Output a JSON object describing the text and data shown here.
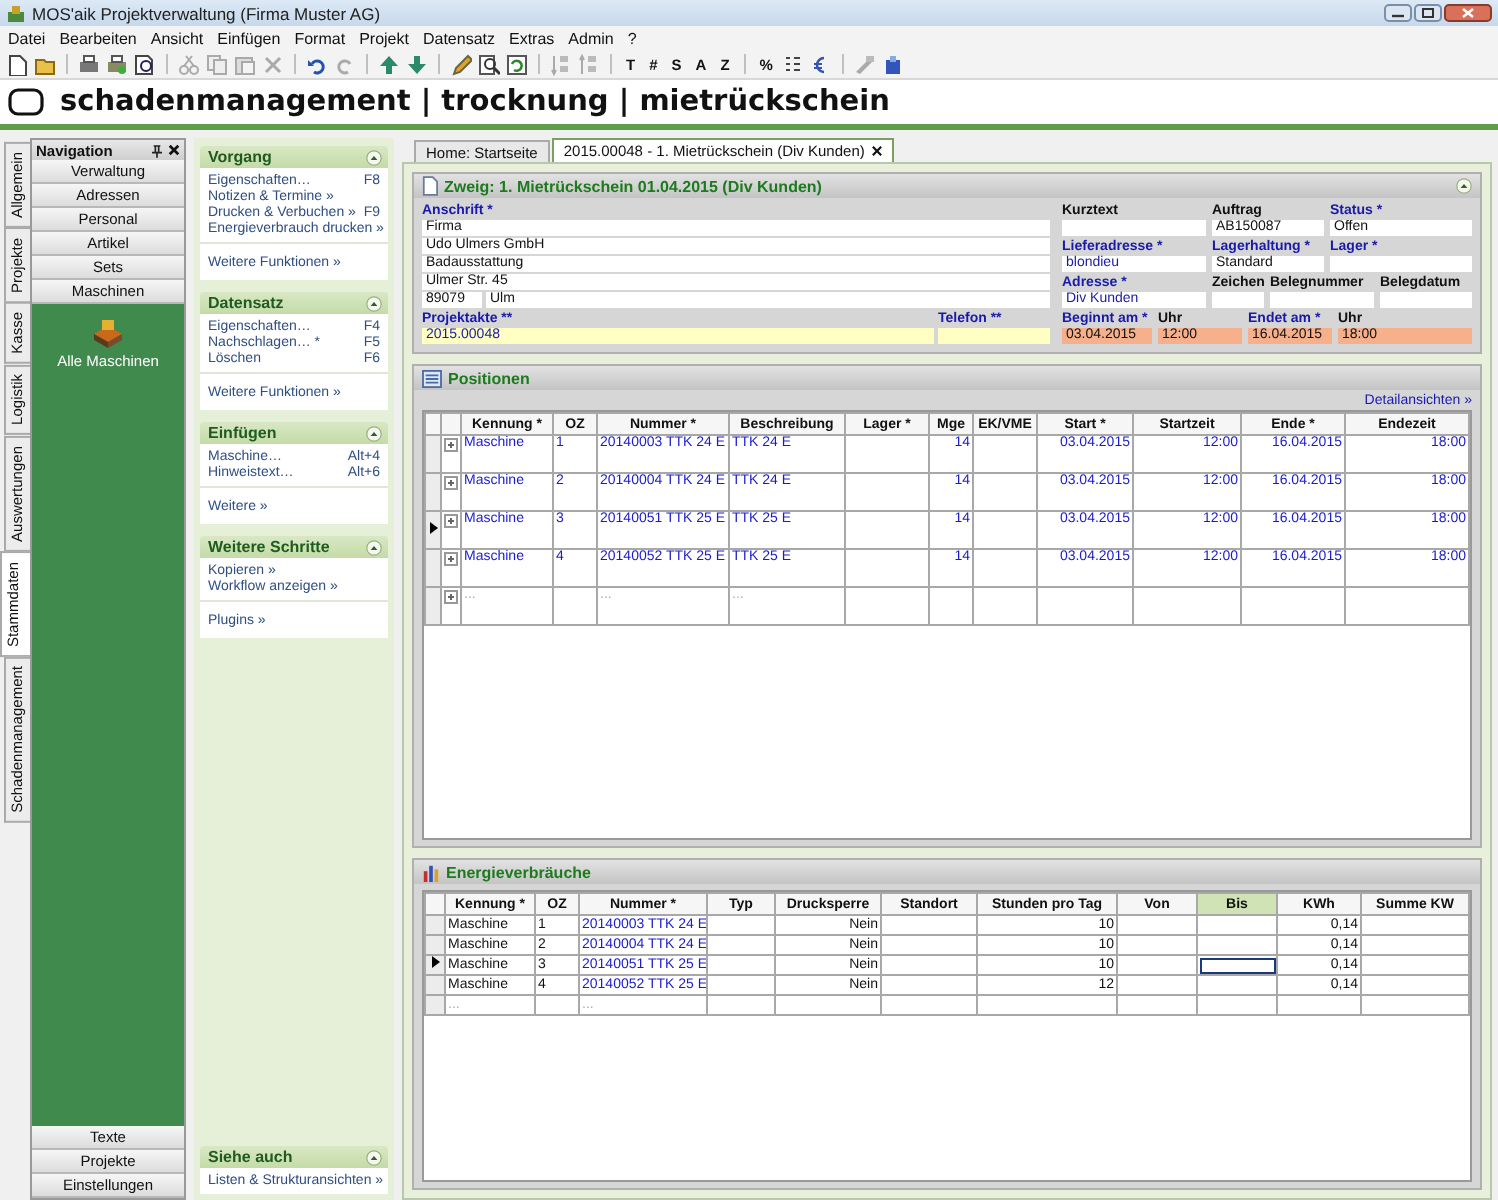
{
  "window": {
    "title": "MOS'aik Projektverwaltung (Firma Muster AG)"
  },
  "menu": [
    "Datei",
    "Bearbeiten",
    "Ansicht",
    "Einfügen",
    "Format",
    "Projekt",
    "Datensatz",
    "Extras",
    "Admin",
    "?"
  ],
  "toolbar": {
    "letters": [
      "T",
      "#",
      "S",
      "A",
      "Z"
    ],
    "percent": "%"
  },
  "banner": {
    "title": "schadenmanagement | trocknung | mietrückschein"
  },
  "side_tabs": [
    {
      "label": "Allgemein",
      "selected": false
    },
    {
      "label": "Projekte",
      "selected": false
    },
    {
      "label": "Kasse",
      "selected": false
    },
    {
      "label": "Logistik",
      "selected": false
    },
    {
      "label": "Auswertungen",
      "selected": false
    },
    {
      "label": "Stammdaten",
      "selected": true
    },
    {
      "label": "Schadenmanagement",
      "selected": false
    }
  ],
  "navigation": {
    "title": "Navigation",
    "top_buttons": [
      "Verwaltung",
      "Adressen",
      "Personal",
      "Artikel",
      "Sets",
      "Maschinen"
    ],
    "items": [
      "Alle Maschinen"
    ],
    "bottom_buttons": [
      "Texte",
      "Projekte",
      "Einstellungen"
    ]
  },
  "tasks": {
    "groups": [
      {
        "title": "Vorgang",
        "items": [
          {
            "label": "Eigenschaften…",
            "shortcut": "F8"
          },
          {
            "label": "Notizen & Termine »"
          },
          {
            "label": "Drucken & Verbuchen »",
            "shortcut": "F9"
          },
          {
            "label": "Energieverbrauch drucken »"
          }
        ],
        "more": [
          "Weitere Funktionen »"
        ]
      },
      {
        "title": "Datensatz",
        "items": [
          {
            "label": "Eigenschaften…",
            "shortcut": "F4"
          },
          {
            "label": "Nachschlagen… *",
            "shortcut": "F5"
          },
          {
            "label": "Löschen",
            "shortcut": "F6"
          }
        ],
        "more": [
          "Weitere Funktionen »"
        ]
      },
      {
        "title": "Einfügen",
        "items": [
          {
            "label": "Maschine…",
            "shortcut": "Alt+4"
          },
          {
            "label": "Hinweistext…",
            "shortcut": "Alt+6"
          }
        ],
        "more": [
          "Weitere »"
        ]
      },
      {
        "title": "Weitere Schritte",
        "items": [
          {
            "label": "Kopieren »"
          },
          {
            "label": "Workflow anzeigen »"
          }
        ],
        "more": [
          "Plugins »"
        ]
      }
    ],
    "see_also": {
      "title": "Siehe auch",
      "links": [
        "Listen & Strukturansichten »"
      ]
    }
  },
  "tabs": [
    {
      "label": "Home: Startseite",
      "selected": false,
      "closable": false
    },
    {
      "label": "2015.00048 - 1. Mietrückschein (Div Kunden)",
      "selected": true,
      "closable": true
    }
  ],
  "form": {
    "title": "Zweig: 1. Mietrückschein 01.04.2015 (Div Kunden)",
    "address": {
      "label": "Anschrift *",
      "required": true,
      "lines": [
        "Firma",
        "Udo Ulmers GmbH",
        "Badausstattung",
        "Ulmer Str. 45"
      ],
      "zip": "89079",
      "city": "Ulm"
    },
    "project": {
      "label": "Projektakte **",
      "required": true,
      "value": "2015.00048",
      "color": "#ffffc4",
      "linked": true
    },
    "phone": {
      "label": "Telefon **",
      "required": true,
      "color": "#ffffc4"
    },
    "grid": [
      [
        {
          "label": "Kurztext",
          "required": false,
          "color": "#ffffff"
        },
        {
          "label": "Auftrag",
          "required": false,
          "value": "AB150087",
          "color": "#ffffff",
          "linked": false
        },
        {
          "label": "Status *",
          "required": true,
          "value": "Offen",
          "color": "#ffffff",
          "linked": false
        }
      ],
      [
        {
          "label": "Lieferadresse *",
          "required": true,
          "value": "blondieu",
          "color": "#ffffff",
          "linked": true
        },
        {
          "label": "Lagerhaltung *",
          "required": true,
          "value": "Standard",
          "color": "#ffffff",
          "linked": false
        },
        {
          "label": "Lager *",
          "required": true,
          "color": "#ffffff"
        }
      ],
      [
        {
          "label": "Adresse *",
          "required": true,
          "value": "Div Kunden",
          "color": "#ffffff",
          "linked": true
        },
        {
          "label": "Zeichen",
          "required": false,
          "color": "#ffffff"
        },
        {
          "label": "Belegnummer",
          "required": false,
          "color": "#ffffff"
        },
        {
          "label": "Belegdatum",
          "required": false,
          "color": "#ffffff"
        }
      ],
      [
        {
          "label": "Beginnt am *",
          "required": true,
          "value": "03.04.2015",
          "color": "#f6b08c",
          "linked": false
        },
        {
          "label": "Uhr",
          "required": false,
          "value": "12:00",
          "color": "#f6b08c",
          "linked": false
        },
        {
          "label": "Endet am *",
          "required": true,
          "value": "16.04.2015",
          "color": "#f6b08c",
          "linked": false
        },
        {
          "label": "Uhr",
          "required": false,
          "value": "18:00",
          "color": "#f6b08c",
          "linked": false
        }
      ]
    ]
  },
  "positions": {
    "title": "Positionen",
    "link": "Detailansichten »",
    "columns": [
      "Kennung *",
      "OZ",
      "Nummer *",
      "Beschreibung",
      "Lager *",
      "Mge",
      "EK/VME",
      "Start *",
      "Startzeit",
      "Ende *",
      "Endezeit"
    ],
    "rows": [
      {
        "kind": "item",
        "current": false,
        "cells": [
          "Maschine",
          "1",
          "20140003 TTK 24 E",
          "TTK 24 E",
          null,
          "14",
          null,
          "03.04.2015",
          "12:00",
          "16.04.2015",
          "18:00"
        ]
      },
      {
        "kind": "item",
        "current": false,
        "cells": [
          "Maschine",
          "2",
          "20140004 TTK 24 E",
          "TTK 24 E",
          null,
          "14",
          null,
          "03.04.2015",
          "12:00",
          "16.04.2015",
          "18:00"
        ]
      },
      {
        "kind": "item",
        "current": true,
        "cells": [
          "Maschine",
          "3",
          "20140051 TTK 25 E",
          "TTK 25 E",
          null,
          "14",
          null,
          "03.04.2015",
          "12:00",
          "16.04.2015",
          "18:00"
        ]
      },
      {
        "kind": "item",
        "current": false,
        "cells": [
          "Maschine",
          "4",
          "20140052 TTK 25 E",
          "TTK 25 E",
          null,
          "14",
          null,
          "03.04.2015",
          "12:00",
          "16.04.2015",
          "18:00"
        ]
      },
      {
        "kind": "new",
        "current": false,
        "cells": [
          "...",
          null,
          "...",
          "...",
          null,
          null,
          null,
          null,
          null,
          null,
          null
        ]
      }
    ]
  },
  "energy": {
    "title": "Energieverbräuche",
    "columns": [
      {
        "label": "Kennung *",
        "selected": false
      },
      {
        "label": "OZ",
        "selected": false
      },
      {
        "label": "Nummer *",
        "selected": false
      },
      {
        "label": "Typ",
        "selected": false
      },
      {
        "label": "Drucksperre",
        "selected": false
      },
      {
        "label": "Standort",
        "selected": false
      },
      {
        "label": "Stunden pro Tag",
        "selected": false
      },
      {
        "label": "Von",
        "selected": false
      },
      {
        "label": "Bis",
        "selected": true
      },
      {
        "label": "KWh",
        "selected": false
      },
      {
        "label": "Summe KW",
        "selected": false
      }
    ],
    "rows": [
      {
        "kind": "item",
        "current": false,
        "cells": [
          "Maschine",
          "1",
          "20140003 TTK 24 E",
          null,
          "Nein",
          null,
          "10",
          null,
          null,
          "0,14",
          null
        ]
      },
      {
        "kind": "item",
        "current": false,
        "cells": [
          "Maschine",
          "2",
          "20140004 TTK 24 E",
          null,
          "Nein",
          null,
          "10",
          null,
          null,
          "0,14",
          null
        ]
      },
      {
        "kind": "item",
        "current": true,
        "cells": [
          "Maschine",
          "3",
          "20140051 TTK 25 E",
          null,
          "Nein",
          null,
          "10",
          null,
          null,
          "0,14",
          null
        ]
      },
      {
        "kind": "item",
        "current": false,
        "cells": [
          "Maschine",
          "4",
          "20140052 TTK 25 E",
          null,
          "Nein",
          null,
          "12",
          null,
          null,
          "0,14",
          null
        ]
      },
      {
        "kind": "new",
        "current": false,
        "cells": [
          "...",
          null,
          "...",
          null,
          null,
          null,
          null,
          null,
          null,
          null,
          null
        ]
      }
    ]
  }
}
